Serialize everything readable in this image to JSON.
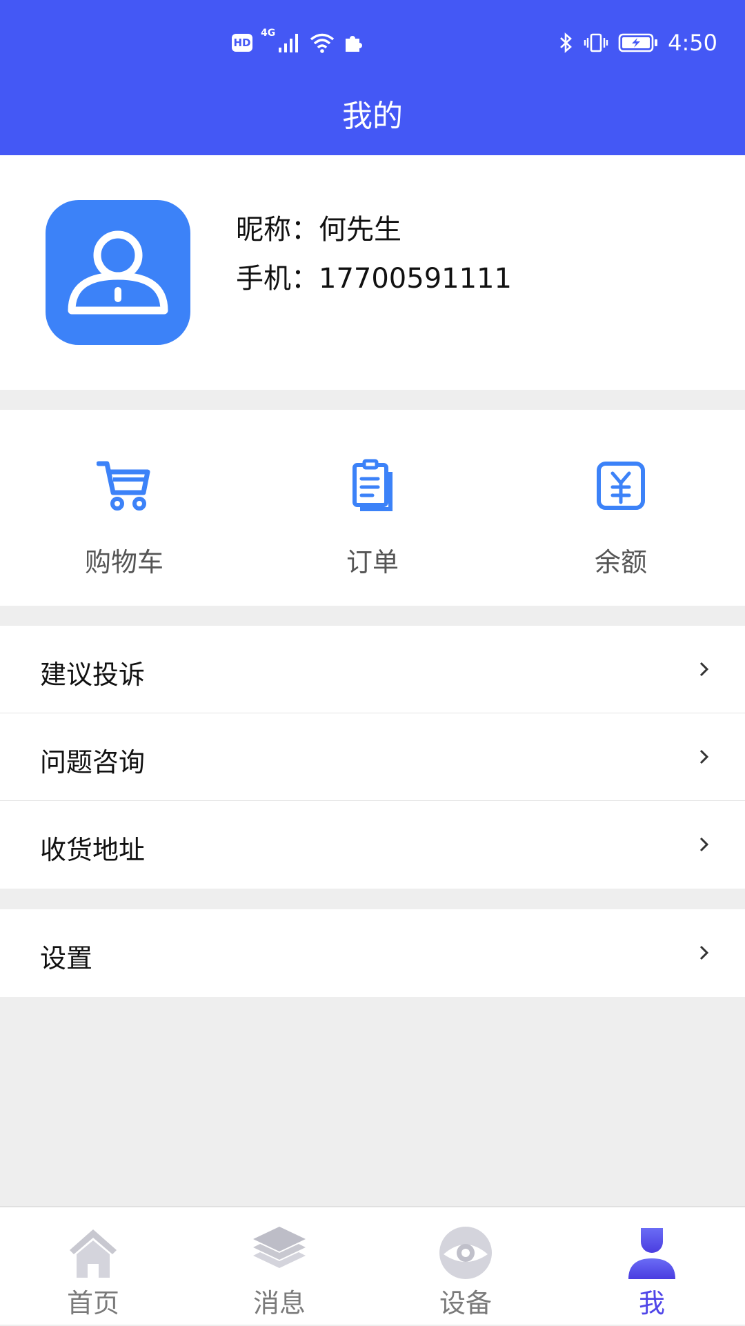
{
  "status_bar": {
    "hd_badge": "HD",
    "network_label": "4G",
    "time": "4:50",
    "icons": [
      "hd-icon",
      "signal-icon",
      "wifi-icon",
      "puzzle-icon",
      "bluetooth-icon",
      "vibrate-icon",
      "battery-charging-icon"
    ]
  },
  "header": {
    "title": "我的"
  },
  "profile": {
    "nickname_line": "昵称：何先生",
    "phone_line": "手机：17700591111",
    "avatar_icon": "user-avatar-icon"
  },
  "quick_actions": [
    {
      "label": "购物车",
      "icon": "shopping-cart-icon"
    },
    {
      "label": "订单",
      "icon": "clipboard-icon"
    },
    {
      "label": "余额",
      "icon": "yuan-wallet-icon"
    }
  ],
  "menu_group_1": [
    {
      "label": "建议投诉"
    },
    {
      "label": "问题咨询"
    },
    {
      "label": "收货地址"
    }
  ],
  "menu_group_2": [
    {
      "label": "设置"
    }
  ],
  "bottom_nav": [
    {
      "label": "首页",
      "icon": "home-icon",
      "active": false
    },
    {
      "label": "消息",
      "icon": "layers-icon",
      "active": false
    },
    {
      "label": "设备",
      "icon": "device-icon",
      "active": false
    },
    {
      "label": "我",
      "icon": "person-icon",
      "active": true
    }
  ],
  "colors": {
    "primary": "#4458f5",
    "icon_blue": "#3c82f8",
    "nav_active": "#5046e8",
    "nav_inactive": "#c8c8d0",
    "background": "#eeeeee"
  }
}
